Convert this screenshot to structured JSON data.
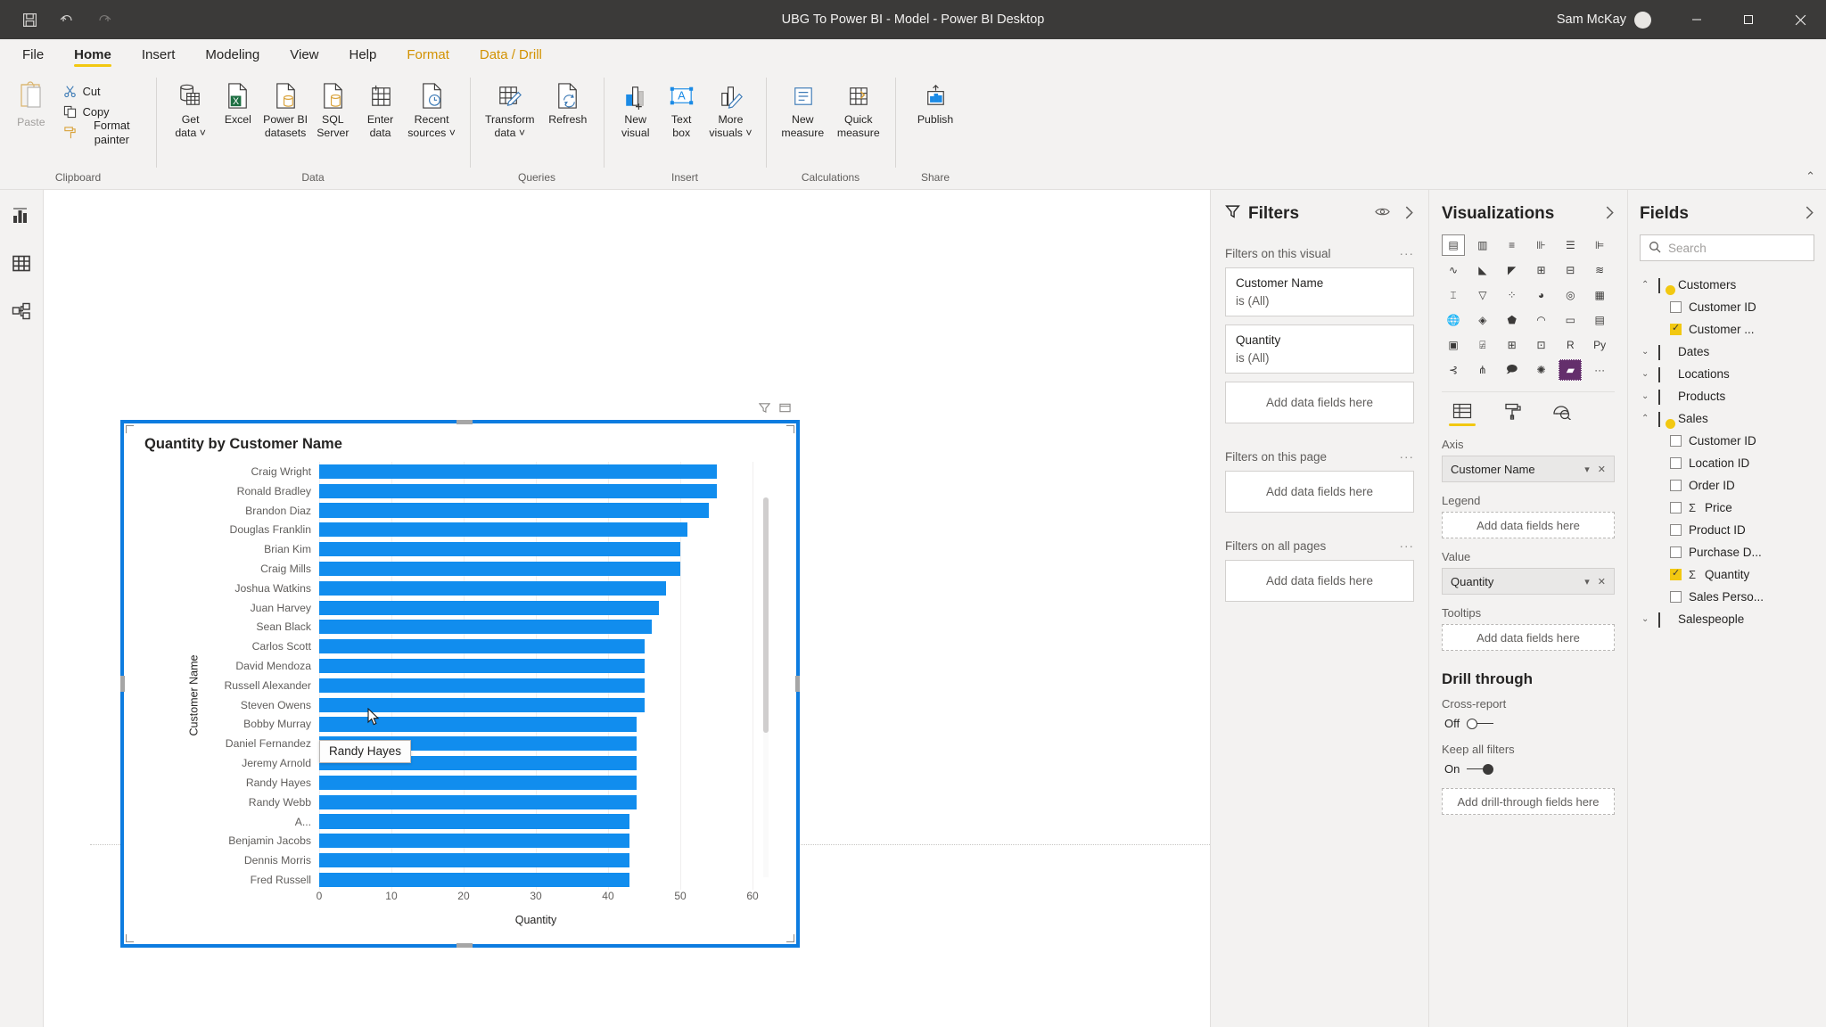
{
  "titlebar": {
    "save_icon": "save-icon",
    "undo_icon": "undo-icon",
    "redo_icon": "redo-icon",
    "title": "UBG To Power BI - Model - Power BI Desktop",
    "user": "Sam McKay",
    "minimize": "–",
    "maximize": "▢",
    "close": "✕"
  },
  "ribbon": {
    "tabs": [
      {
        "label": "File",
        "state": "normal"
      },
      {
        "label": "Home",
        "state": "active"
      },
      {
        "label": "Insert",
        "state": "normal"
      },
      {
        "label": "Modeling",
        "state": "normal"
      },
      {
        "label": "View",
        "state": "normal"
      },
      {
        "label": "Help",
        "state": "normal"
      },
      {
        "label": "Format",
        "state": "contextual"
      },
      {
        "label": "Data / Drill",
        "state": "contextual"
      }
    ],
    "groups": [
      {
        "label": "Clipboard",
        "paste": "Paste",
        "items": [
          {
            "label": "Cut",
            "icon": "scissors-icon"
          },
          {
            "label": "Copy",
            "icon": "copy-icon"
          },
          {
            "label": "Format painter",
            "icon": "format-painter-icon"
          }
        ]
      },
      {
        "label": "Data",
        "items": [
          {
            "l1": "Get",
            "l2": "data ˅",
            "icon": "database-icon"
          },
          {
            "l1": "Excel",
            "l2": "",
            "icon": "excel-icon"
          },
          {
            "l1": "Power BI",
            "l2": "datasets",
            "icon": "powerbi-dataset-icon"
          },
          {
            "l1": "SQL",
            "l2": "Server",
            "icon": "sql-server-icon"
          },
          {
            "l1": "Enter",
            "l2": "data",
            "icon": "enter-data-icon"
          },
          {
            "l1": "Recent",
            "l2": "sources ˅",
            "icon": "recent-sources-icon"
          }
        ]
      },
      {
        "label": "Queries",
        "items": [
          {
            "l1": "Transform",
            "l2": "data ˅",
            "icon": "transform-data-icon"
          },
          {
            "l1": "Refresh",
            "l2": "",
            "icon": "refresh-icon"
          }
        ]
      },
      {
        "label": "Insert",
        "items": [
          {
            "l1": "New",
            "l2": "visual",
            "icon": "new-visual-icon"
          },
          {
            "l1": "Text",
            "l2": "box",
            "icon": "text-box-icon"
          },
          {
            "l1": "More",
            "l2": "visuals ˅",
            "icon": "more-visuals-icon"
          }
        ]
      },
      {
        "label": "Calculations",
        "items": [
          {
            "l1": "New",
            "l2": "measure",
            "icon": "new-measure-icon"
          },
          {
            "l1": "Quick",
            "l2": "measure",
            "icon": "quick-measure-icon"
          }
        ]
      },
      {
        "label": "Share",
        "items": [
          {
            "l1": "Publish",
            "l2": "",
            "icon": "publish-icon"
          }
        ]
      }
    ],
    "collapse_icon": "chevron-up-icon"
  },
  "leftnav": {
    "items": [
      {
        "name": "report-view",
        "icon": "bar-chart-icon",
        "active": true
      },
      {
        "name": "data-view",
        "icon": "table-icon",
        "active": false
      },
      {
        "name": "model-view",
        "icon": "model-relationship-icon",
        "active": false
      }
    ]
  },
  "chart_data": {
    "type": "bar",
    "title": "Quantity by Customer Name",
    "xlabel": "Quantity",
    "ylabel": "Customer Name",
    "orientation": "horizontal",
    "xlim": [
      0,
      60
    ],
    "xticks": [
      0,
      10,
      20,
      30,
      40,
      50,
      60
    ],
    "grid": true,
    "bar_color": "#118dee",
    "categories": [
      "Craig Wright",
      "Ronald Bradley",
      "Brandon Diaz",
      "Douglas Franklin",
      "Brian Kim",
      "Craig Mills",
      "Joshua Watkins",
      "Juan Harvey",
      "Sean Black",
      "Carlos Scott",
      "David Mendoza",
      "Russell Alexander",
      "Steven Owens",
      "Bobby Murray",
      "Daniel Fernandez",
      "Jeremy Arnold",
      "Randy Hayes",
      "Randy Webb",
      "A...",
      "Benjamin Jacobs",
      "Dennis Morris",
      "Fred Russell"
    ],
    "values": [
      55,
      55,
      54,
      51,
      50,
      50,
      48,
      47,
      46,
      45,
      45,
      45,
      45,
      44,
      44,
      44,
      44,
      44,
      43,
      43,
      43,
      43
    ]
  },
  "visual": {
    "tooltip_text": "Randy Hayes",
    "header_icons": [
      "filter-icon",
      "focus-mode-icon"
    ],
    "scrollbar": "vertical-scrollbar"
  },
  "filters": {
    "title": "Filters",
    "funnel_icon": "funnel-icon",
    "eye_icon": "eye-icon",
    "expand_icon": "chevron-right-icon",
    "sections": [
      {
        "label": "Filters on this visual",
        "menu": "···",
        "cards": [
          {
            "name": "Customer Name",
            "value": "is (All)"
          },
          {
            "name": "Quantity",
            "value": "is (All)"
          }
        ],
        "drop_label": "Add data fields here"
      },
      {
        "label": "Filters on this page",
        "menu": "···",
        "cards": [],
        "drop_label": "Add data fields here"
      },
      {
        "label": "Filters on all pages",
        "menu": "···",
        "cards": [],
        "drop_label": "Add data fields here"
      }
    ]
  },
  "visualizations": {
    "title": "Visualizations",
    "expand_icon": "chevron-right-icon",
    "gallery": [
      {
        "icon": "stacked-bar-chart-icon",
        "state": "selected-dark"
      },
      {
        "icon": "stacked-column-chart-icon",
        "state": "normal"
      },
      {
        "icon": "clustered-bar-chart-icon",
        "state": "normal"
      },
      {
        "icon": "clustered-column-chart-icon",
        "state": "normal"
      },
      {
        "icon": "100-stacked-bar-chart-icon",
        "state": "normal"
      },
      {
        "icon": "100-stacked-column-chart-icon",
        "state": "normal"
      },
      {
        "icon": "line-chart-icon",
        "state": "normal"
      },
      {
        "icon": "area-chart-icon",
        "state": "normal"
      },
      {
        "icon": "stacked-area-chart-icon",
        "state": "normal"
      },
      {
        "icon": "line-stacked-column-chart-icon",
        "state": "normal"
      },
      {
        "icon": "line-clustered-column-chart-icon",
        "state": "normal"
      },
      {
        "icon": "ribbon-chart-icon",
        "state": "normal"
      },
      {
        "icon": "waterfall-chart-icon",
        "state": "normal"
      },
      {
        "icon": "funnel-chart-icon",
        "state": "normal"
      },
      {
        "icon": "scatter-chart-icon",
        "state": "normal"
      },
      {
        "icon": "pie-chart-icon",
        "state": "normal"
      },
      {
        "icon": "donut-chart-icon",
        "state": "normal"
      },
      {
        "icon": "treemap-icon",
        "state": "normal"
      },
      {
        "icon": "map-icon",
        "state": "normal"
      },
      {
        "icon": "filled-map-icon",
        "state": "normal"
      },
      {
        "icon": "shape-map-icon",
        "state": "normal"
      },
      {
        "icon": "gauge-icon",
        "state": "normal"
      },
      {
        "icon": "card-icon",
        "state": "normal"
      },
      {
        "icon": "multi-row-card-icon",
        "state": "normal"
      },
      {
        "icon": "kpi-icon",
        "state": "normal"
      },
      {
        "icon": "slicer-icon",
        "state": "normal"
      },
      {
        "icon": "table-icon",
        "state": "normal"
      },
      {
        "icon": "matrix-icon",
        "state": "normal"
      },
      {
        "icon": "r-script-visual-icon",
        "state": "normal"
      },
      {
        "icon": "python-visual-icon",
        "state": "normal"
      },
      {
        "icon": "key-influencers-icon",
        "state": "normal"
      },
      {
        "icon": "decomposition-tree-icon",
        "state": "normal"
      },
      {
        "icon": "qa-visual-icon",
        "state": "normal"
      },
      {
        "icon": "smart-narrative-icon",
        "state": "normal"
      },
      {
        "icon": "paginated-report-icon",
        "state": "selected-purple"
      },
      {
        "icon": "more-options-icon",
        "state": "normal"
      }
    ],
    "tabs": [
      {
        "icon": "fields-tab-icon",
        "active": true
      },
      {
        "icon": "format-paint-roller-icon",
        "active": false
      },
      {
        "icon": "analytics-magnifier-icon",
        "active": false
      }
    ],
    "wells": [
      {
        "label": "Axis",
        "value": "Customer Name",
        "filled": true
      },
      {
        "label": "Legend",
        "value": "Add data fields here",
        "filled": false
      },
      {
        "label": "Value",
        "value": "Quantity",
        "filled": true
      },
      {
        "label": "Tooltips",
        "value": "Add data fields here",
        "filled": false
      }
    ],
    "drill": {
      "title": "Drill through",
      "cross_report_label": "Cross-report",
      "cross_report_state": "Off",
      "keep_filters_label": "Keep all filters",
      "keep_filters_state": "On",
      "drop_label": "Add drill-through fields here"
    }
  },
  "fields": {
    "title": "Fields",
    "expand_icon": "chevron-right-icon",
    "search_placeholder": "Search",
    "search_icon": "search-icon",
    "tables": [
      {
        "name": "Customers",
        "expanded": true,
        "has_relationship": true,
        "fields": [
          {
            "label": "Customer ID",
            "checked": false,
            "aggregate": false
          },
          {
            "label": "Customer ...",
            "checked": true,
            "aggregate": false
          }
        ]
      },
      {
        "name": "Dates",
        "expanded": false,
        "has_relationship": false,
        "fields": []
      },
      {
        "name": "Locations",
        "expanded": false,
        "has_relationship": false,
        "fields": []
      },
      {
        "name": "Products",
        "expanded": false,
        "has_relationship": false,
        "fields": []
      },
      {
        "name": "Sales",
        "expanded": true,
        "has_relationship": true,
        "fields": [
          {
            "label": "Customer ID",
            "checked": false,
            "aggregate": false
          },
          {
            "label": "Location ID",
            "checked": false,
            "aggregate": false
          },
          {
            "label": "Order ID",
            "checked": false,
            "aggregate": false
          },
          {
            "label": "Price",
            "checked": false,
            "aggregate": true
          },
          {
            "label": "Product ID",
            "checked": false,
            "aggregate": false
          },
          {
            "label": "Purchase D...",
            "checked": false,
            "aggregate": false
          },
          {
            "label": "Quantity",
            "checked": true,
            "aggregate": true
          },
          {
            "label": "Sales Perso...",
            "checked": false,
            "aggregate": false
          }
        ]
      },
      {
        "name": "Salespeople",
        "expanded": false,
        "has_relationship": false,
        "fields": []
      }
    ]
  }
}
